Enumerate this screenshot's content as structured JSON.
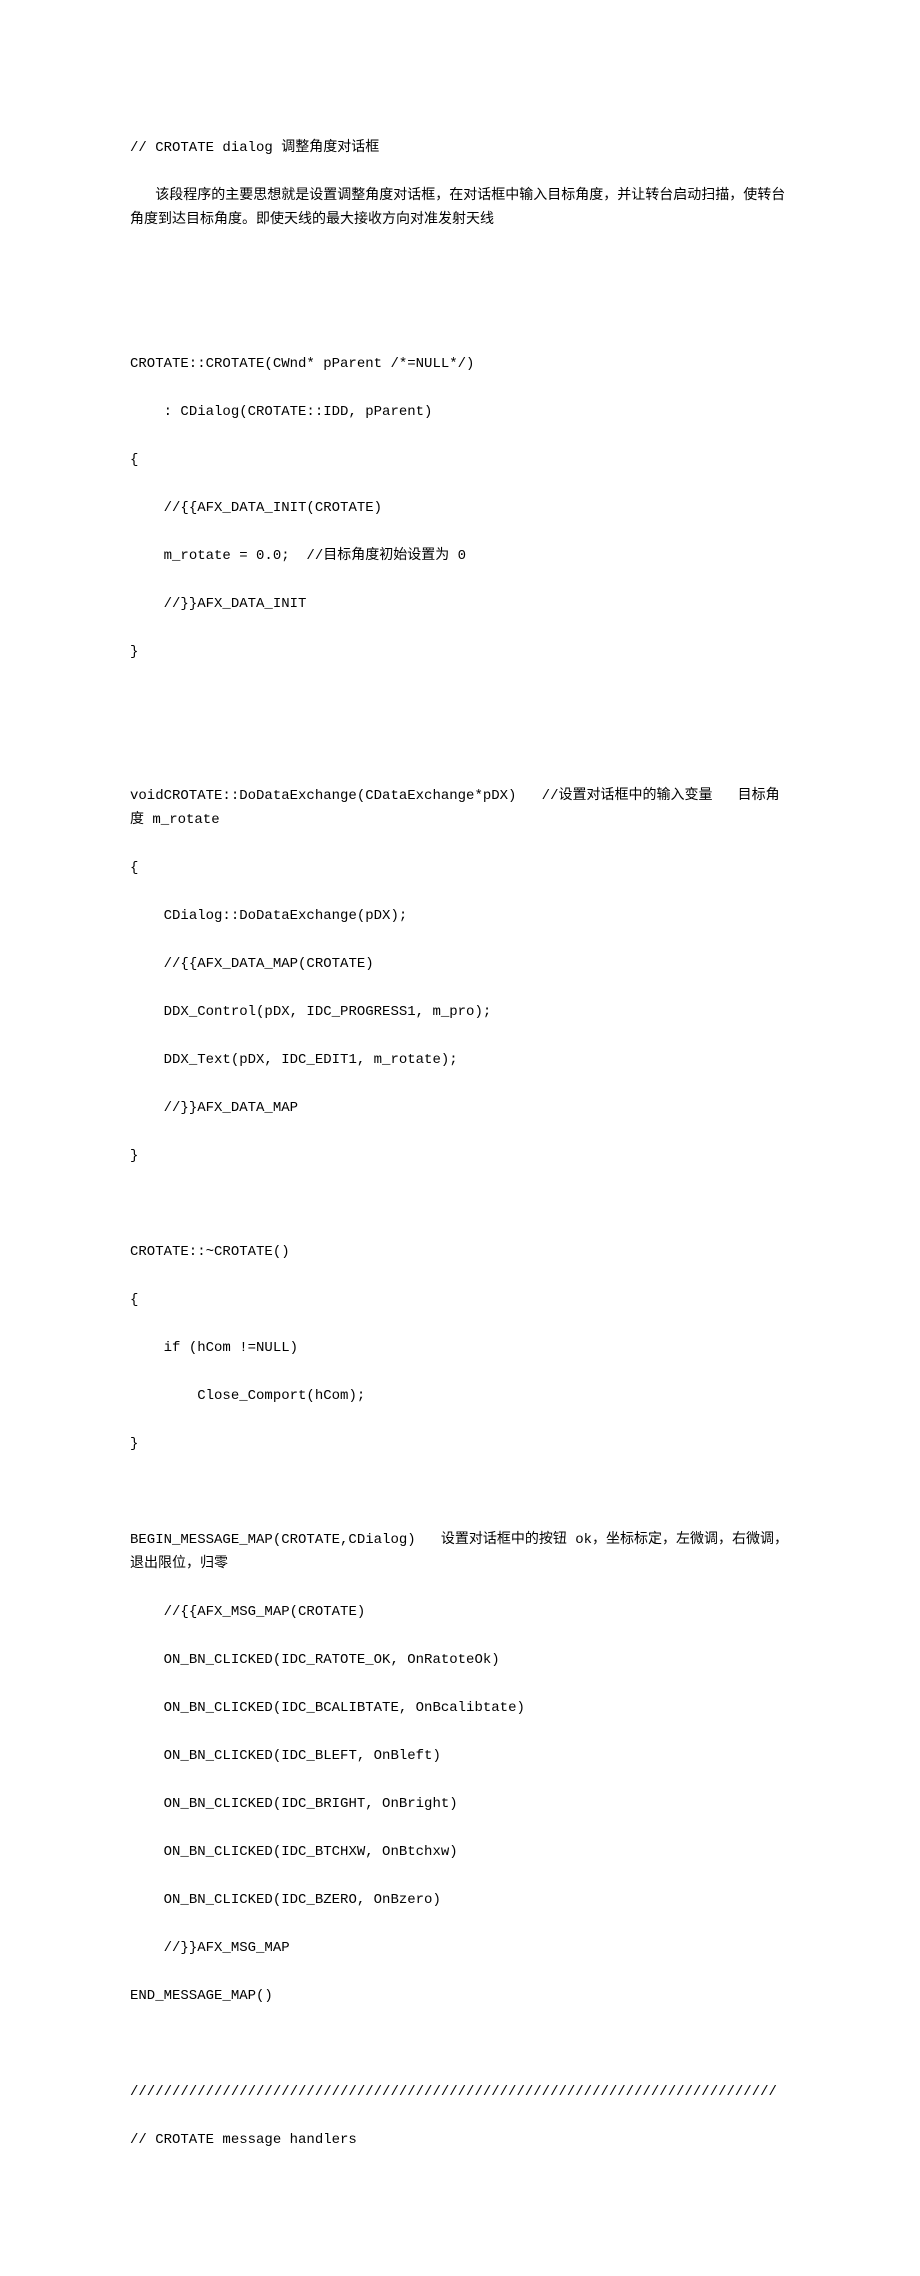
{
  "lines": {
    "l1": "// CROTATE dialog 调整角度对话框",
    "l2": "   该段程序的主要思想就是设置调整角度对话框，在对话框中输入目标角度，并让转台启动扫描，使转台角度到达目标角度。即使天线的最大接收方向对准发射天线",
    "l3": "",
    "l4": "",
    "l5": "CROTATE::CROTATE(CWnd* pParent /*=NULL*/)",
    "l6": "    : CDialog(CROTATE::IDD, pParent)",
    "l7": "{",
    "l8": "    //{{AFX_DATA_INIT(CROTATE)",
    "l9": "    m_rotate = 0.0;  //目标角度初始设置为 0",
    "l10": "    //}}AFX_DATA_INIT",
    "l11": "}",
    "l12": "",
    "l13": "",
    "l14": "voidCROTATE::DoDataExchange(CDataExchange*pDX)   //设置对话框中的输入变量   目标角度 m_rotate",
    "l15": "{",
    "l16": "    CDialog::DoDataExchange(pDX);",
    "l17": "    //{{AFX_DATA_MAP(CROTATE)",
    "l18": "    DDX_Control(pDX, IDC_PROGRESS1, m_pro);",
    "l19": "    DDX_Text(pDX, IDC_EDIT1, m_rotate);",
    "l20": "    //}}AFX_DATA_MAP",
    "l21": "}",
    "l22": "",
    "l23": "CROTATE::~CROTATE()",
    "l24": "{",
    "l25": "    if (hCom !=NULL)",
    "l26": "        Close_Comport(hCom);",
    "l27": "}",
    "l28": "",
    "l29": "BEGIN_MESSAGE_MAP(CROTATE,CDialog)   设置对话框中的按钮 ok，坐标标定，左微调，右微调，退出限位，归零",
    "l30": "    //{{AFX_MSG_MAP(CROTATE)",
    "l31": "    ON_BN_CLICKED(IDC_RATOTE_OK, OnRatoteOk)",
    "l32": "    ON_BN_CLICKED(IDC_BCALIBTATE, OnBcalibtate)",
    "l33": "    ON_BN_CLICKED(IDC_BLEFT, OnBleft)",
    "l34": "    ON_BN_CLICKED(IDC_BRIGHT, OnBright)",
    "l35": "    ON_BN_CLICKED(IDC_BTCHXW, OnBtchxw)",
    "l36": "    ON_BN_CLICKED(IDC_BZERO, OnBzero)",
    "l37": "    //}}AFX_MSG_MAP",
    "l38": "END_MESSAGE_MAP()",
    "l39": "",
    "l40": "/////////////////////////////////////////////////////////////////////////////",
    "l41": "// CROTATE message handlers"
  }
}
